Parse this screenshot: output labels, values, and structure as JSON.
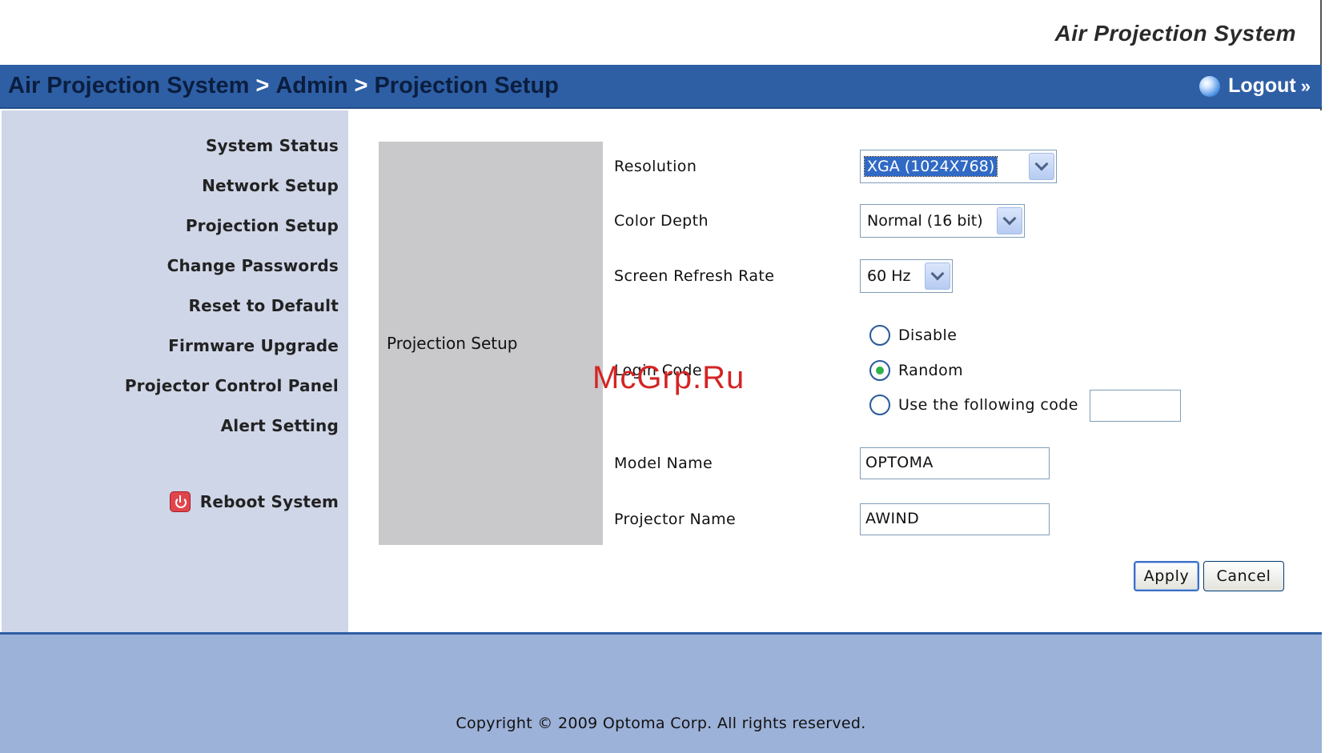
{
  "header": {
    "brand": "Air Projection System",
    "breadcrumb": [
      "Air Projection System",
      "Admin",
      "Projection Setup"
    ],
    "breadcrumb_sep": ">",
    "logout_label": "Logout",
    "logout_arrow": "»"
  },
  "sidebar": {
    "items": [
      {
        "label": "System Status"
      },
      {
        "label": "Network Setup"
      },
      {
        "label": "Projection Setup"
      },
      {
        "label": "Change Passwords"
      },
      {
        "label": "Reset to Default"
      },
      {
        "label": "Firmware Upgrade"
      },
      {
        "label": "Projector Control Panel"
      },
      {
        "label": "Alert Setting"
      }
    ],
    "reboot_label": "Reboot System"
  },
  "form": {
    "section_title": "Projection Setup",
    "resolution": {
      "label": "Resolution",
      "value": "XGA (1024X768)"
    },
    "color_depth": {
      "label": "Color Depth",
      "value": "Normal (16 bit)"
    },
    "refresh_rate": {
      "label": "Screen Refresh Rate",
      "value": "60 Hz"
    },
    "login_code": {
      "label": "Login Code",
      "options": [
        "Disable",
        "Random",
        "Use the following code"
      ],
      "selected": "Random",
      "code_value": ""
    },
    "model_name": {
      "label": "Model Name",
      "value": "OPTOMA"
    },
    "projector_name": {
      "label": "Projector Name",
      "value": "AWIND"
    },
    "apply_label": "Apply",
    "cancel_label": "Cancel"
  },
  "watermark": "McGrp.Ru",
  "footer": {
    "copyright": "Copyright © 2009 Optoma Corp. All rights reserved."
  }
}
